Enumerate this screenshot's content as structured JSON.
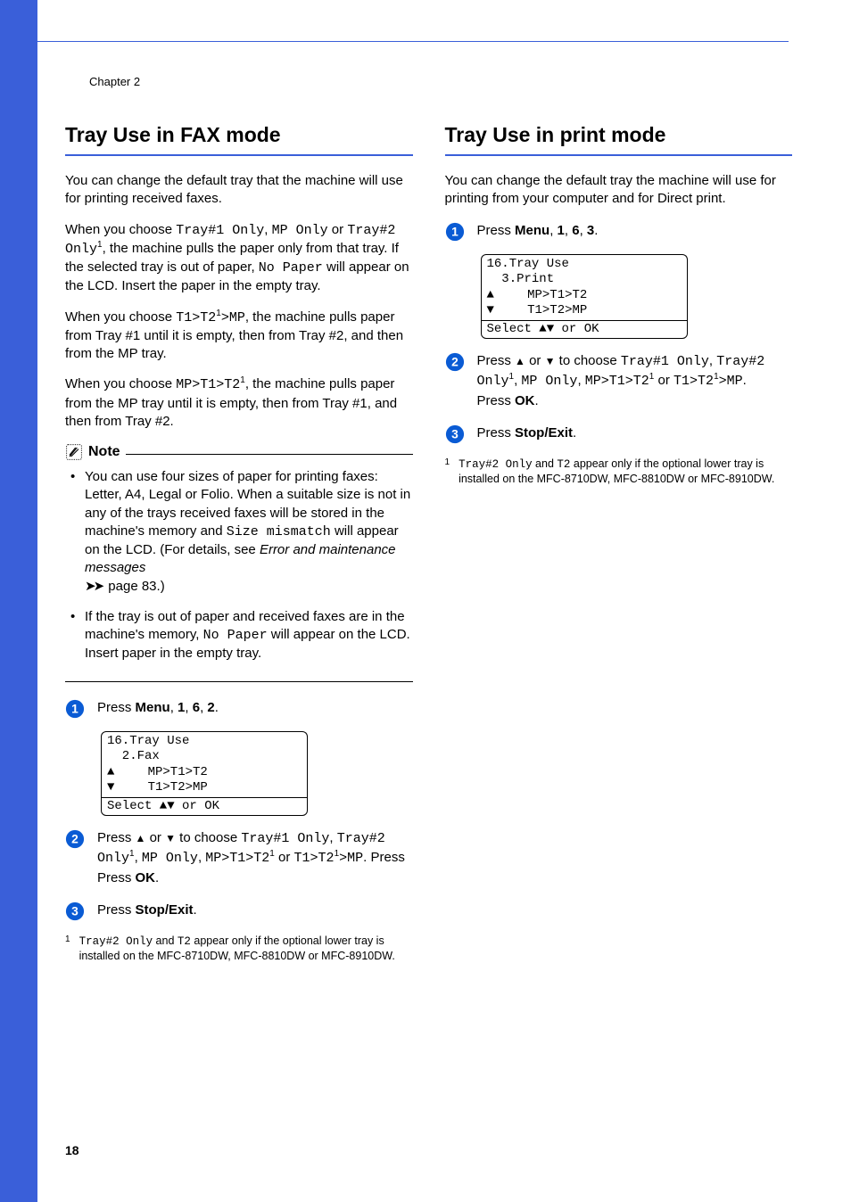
{
  "chapter": "Chapter 2",
  "pageNumber": "18",
  "left": {
    "title": "Tray Use in FAX mode",
    "intro": "You can change the default tray that the machine will use for printing received faxes.",
    "p2a": "When you choose ",
    "p2b": "Tray#1 Only",
    "p2c": ", ",
    "p2d": "MP Only",
    "p2e": " or ",
    "p2f": "Tray#2 Only",
    "p2g": ", the machine pulls the paper only from that tray. If the selected tray is out of paper, ",
    "p2h": "No Paper",
    "p2i": " will appear on the LCD. Insert the paper in the empty tray.",
    "p3a": "When you choose ",
    "p3b": "T1>T2",
    "p3c": ">MP",
    "p3d": ", the machine pulls paper from Tray #1 until it is empty, then from Tray #2, and then from the MP tray.",
    "p4a": "When you choose ",
    "p4b": "MP>T1>T2",
    "p4c": ", the machine pulls paper from the MP tray until it is empty, then from Tray #1, and then from Tray #2.",
    "noteLabel": "Note",
    "note1a": "You can use four sizes of paper for printing faxes: Letter, A4, Legal or Folio. When a suitable size is not in any of the trays received faxes will be stored in the machine's memory and ",
    "note1b": "Size mismatch",
    "note1c": " will appear on the LCD. (For details, see ",
    "note1d": "Error and maintenance messages",
    "note1e": " page 83.)",
    "note2a": "If the tray is out of paper and received faxes are in the machine's memory, ",
    "note2b": "No Paper",
    "note2c": " will appear on the LCD. Insert paper in the empty tray.",
    "step1a": "Press ",
    "step1b": "Menu",
    "step1c": ", ",
    "step1d": "1",
    "step1e": ", ",
    "step1f": "6",
    "step1g": ", ",
    "step1h": "2",
    "step1i": ".",
    "lcd": {
      "l1": "16.Tray Use",
      "l2": "  2.Fax",
      "l3": "    MP>T1>T2",
      "l4": "    T1>T2>MP",
      "l5": "Select ab or OK"
    },
    "step2a": "Press ",
    "step2b": " or ",
    "step2c": " to choose ",
    "step2d": "Tray#1 Only",
    "step2e": ", ",
    "step2f": "Tray#2 Only",
    "step2g": ", ",
    "step2h": "MP Only",
    "step2i": ", ",
    "step2j": "MP>T1>T2",
    "step2k": " or ",
    "step2l": "T1>T2",
    "step2m": ">MP",
    "step2n": ". Press ",
    "step2o": "OK",
    "step2p": ".",
    "step3a": "Press ",
    "step3b": "Stop/Exit",
    "step3c": ".",
    "fn1a": "Tray#2 Only",
    "fn1b": " and ",
    "fn1c": "T2",
    "fn1d": " appear only if the optional lower tray is installed on the MFC-8710DW, MFC-8810DW or MFC-8910DW."
  },
  "right": {
    "title": "Tray Use in print mode",
    "intro": "You can change the default tray the machine will use for printing from your computer and for Direct print.",
    "step1a": "Press ",
    "step1b": "Menu",
    "step1c": ", ",
    "step1d": "1",
    "step1e": ", ",
    "step1f": "6",
    "step1g": ", ",
    "step1h": "3",
    "step1i": ".",
    "lcd": {
      "l1": "16.Tray Use",
      "l2": "  3.Print",
      "l3": "    MP>T1>T2",
      "l4": "    T1>T2>MP",
      "l5": "Select ab or OK"
    },
    "step2a": "Press ",
    "step2b": " or ",
    "step2c": " to choose ",
    "step2d": "Tray#1 Only",
    "step2e": ", ",
    "step2f": "Tray#2 Only",
    "step2g": ", ",
    "step2h": "MP Only",
    "step2i": ", ",
    "step2j": "MP>T1>T2",
    "step2k": " or ",
    "step2l": "T1>T2",
    "step2m": ">MP",
    "step2n": ". Press ",
    "step2o": "OK",
    "step2p": ".",
    "step3a": "Press ",
    "step3b": "Stop/Exit",
    "step3c": ".",
    "fn1a": "Tray#2 Only",
    "fn1b": " and ",
    "fn1c": "T2",
    "fn1d": " appear only if the optional lower tray is installed on the MFC-8710DW, MFC-8810DW or MFC-8910DW."
  }
}
